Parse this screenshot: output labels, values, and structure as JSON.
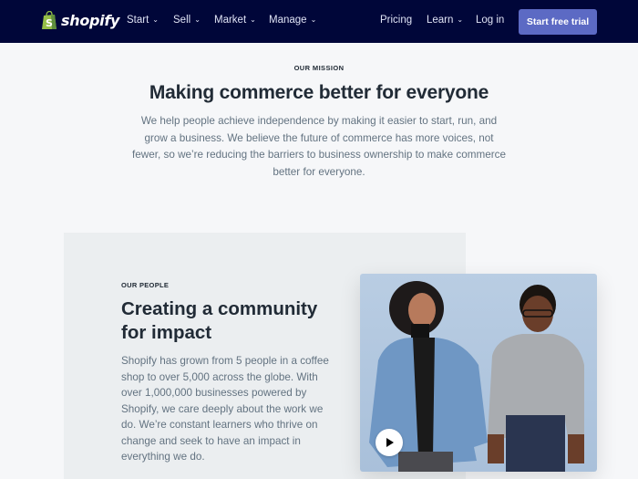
{
  "nav": {
    "logo_text": "shopify",
    "items": [
      {
        "label": "Start",
        "dropdown": true
      },
      {
        "label": "Sell",
        "dropdown": true
      },
      {
        "label": "Market",
        "dropdown": true
      },
      {
        "label": "Manage",
        "dropdown": true
      }
    ],
    "right_items": [
      {
        "label": "Pricing",
        "dropdown": false
      },
      {
        "label": "Learn",
        "dropdown": true
      },
      {
        "label": "Log in",
        "dropdown": false
      }
    ],
    "cta_label": "Start free trial",
    "chevron": "⌄"
  },
  "mission": {
    "eyebrow": "OUR MISSION",
    "title": "Making commerce better for everyone",
    "body": "We help people achieve independence by making it easier to start, run, and grow a business. We believe the future of commerce has more voices, not fewer, so we’re reducing the barriers to business ownership to make commerce better for everyone."
  },
  "people": {
    "eyebrow": "OUR PEOPLE",
    "title": "Creating a community for impact",
    "body": "Shopify has grown from 5 people in a coffee shop to over 5,000 across the globe. With over 1,000,000 businesses powered by Shopify, we care deeply about the work we do. We’re constant learners who thrive on change and seek to have an impact in everything we do.",
    "media": {
      "icon": "play-icon",
      "description": "Two smiling people against a light blue background"
    }
  },
  "colors": {
    "nav_bg": "#000639",
    "cta_bg": "#5c6ac4",
    "brand_green": "#95bf47",
    "page_bg": "#f6f7f9",
    "panel_bg": "#ebeef0"
  }
}
